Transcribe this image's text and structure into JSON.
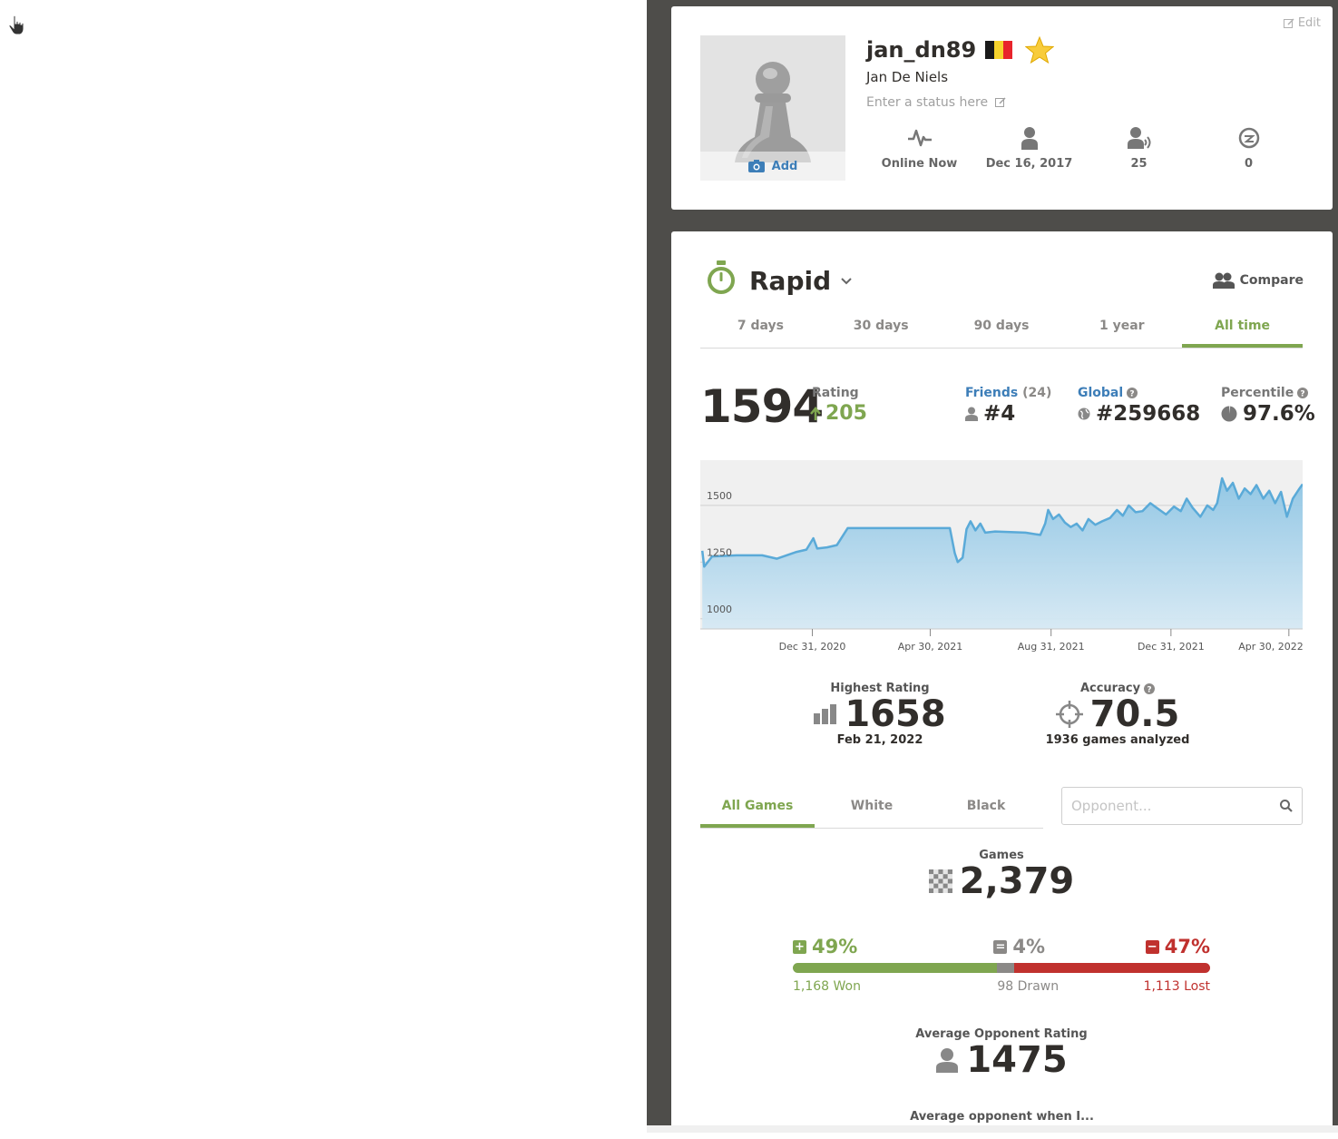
{
  "profile": {
    "edit_label": "Edit",
    "avatar_add_label": "Add",
    "username": "jan_dn89",
    "full_name": "Jan De Niels",
    "status_placeholder": "Enter a status here",
    "stats": [
      {
        "icon": "activity-icon",
        "value": "Online Now"
      },
      {
        "icon": "joined-user-icon",
        "value": "Dec 16, 2017"
      },
      {
        "icon": "followers-icon",
        "value": "25"
      },
      {
        "icon": "views-icon",
        "value": "0"
      }
    ]
  },
  "game_mode": {
    "title": "Rapid",
    "compare_label": "Compare",
    "time_ranges": [
      "7 days",
      "30 days",
      "90 days",
      "1 year",
      "All time"
    ],
    "active_range": "All time"
  },
  "rating": {
    "current": "1594",
    "label": "Rating",
    "change": "205",
    "friends_label": "Friends",
    "friends_count": "(24)",
    "friends_rank": "#4",
    "global_label": "Global",
    "global_rank": "#259668",
    "percentile_label": "Percentile",
    "percentile": "97.6%"
  },
  "chart_data": {
    "type": "area",
    "x_tick_labels": [
      "Dec 31, 2020",
      "Apr 30, 2021",
      "Aug 31, 2021",
      "Dec 31, 2021",
      "Apr 30, 2022"
    ],
    "y_tick_labels": [
      "1500",
      "1250",
      "1000"
    ],
    "ylim": [
      955,
      1700
    ],
    "grid": true,
    "series": [
      {
        "x": [
          "2020-09-10",
          "2020-09-12",
          "2020-09-20",
          "2020-10-15",
          "2020-11-10",
          "2020-11-25",
          "2020-12-15",
          "2020-12-25",
          "2021-01-01",
          "2021-01-05",
          "2021-01-15",
          "2021-01-25",
          "2021-02-05",
          "2021-02-12",
          "2021-02-18",
          "2021-03-20",
          "2021-04-30",
          "2021-05-20",
          "2021-05-25",
          "2021-05-28",
          "2021-06-02",
          "2021-06-06",
          "2021-06-10",
          "2021-06-15",
          "2021-06-20",
          "2021-06-25",
          "2021-07-05",
          "2021-08-05",
          "2021-08-20",
          "2021-08-25",
          "2021-08-28",
          "2021-09-02",
          "2021-09-08",
          "2021-09-14",
          "2021-09-20",
          "2021-09-26",
          "2021-10-02",
          "2021-10-08",
          "2021-10-15",
          "2021-10-22",
          "2021-10-30",
          "2021-11-06",
          "2021-11-12",
          "2021-11-18",
          "2021-11-25",
          "2021-12-02",
          "2021-12-10",
          "2021-12-18",
          "2021-12-26",
          "2022-01-03",
          "2022-01-10",
          "2022-01-16",
          "2022-01-22",
          "2022-01-30",
          "2022-02-06",
          "2022-02-12",
          "2022-02-16",
          "2022-02-21",
          "2022-02-26",
          "2022-03-04",
          "2022-03-10",
          "2022-03-16",
          "2022-03-22",
          "2022-03-28",
          "2022-04-04",
          "2022-04-10",
          "2022-04-16",
          "2022-04-22",
          "2022-04-28",
          "2022-05-04",
          "2022-05-10",
          "2022-05-14"
        ],
        "y": [
          1300,
          1230,
          1275,
          1280,
          1280,
          1265,
          1295,
          1305,
          1355,
          1310,
          1315,
          1325,
          1400,
          1400,
          1400,
          1400,
          1400,
          1400,
          1290,
          1250,
          1270,
          1395,
          1430,
          1390,
          1420,
          1380,
          1385,
          1380,
          1370,
          1420,
          1480,
          1440,
          1460,
          1425,
          1405,
          1420,
          1390,
          1440,
          1415,
          1430,
          1445,
          1480,
          1455,
          1500,
          1470,
          1475,
          1510,
          1485,
          1460,
          1495,
          1475,
          1530,
          1490,
          1450,
          1500,
          1480,
          1510,
          1620,
          1565,
          1600,
          1530,
          1575,
          1550,
          1590,
          1530,
          1565,
          1510,
          1560,
          1450,
          1530,
          1570,
          1594
        ]
      }
    ]
  },
  "highest_rating": {
    "label": "Highest Rating",
    "value": "1658",
    "date": "Feb 21, 2022"
  },
  "accuracy": {
    "label": "Accuracy",
    "value": "70.5",
    "sub": "1936 games analyzed"
  },
  "games_filter": {
    "tabs": [
      "All Games",
      "White",
      "Black"
    ],
    "active": "All Games",
    "opponent_placeholder": "Opponent..."
  },
  "games": {
    "label": "Games",
    "total": "2,379",
    "won_pct": "49%",
    "drawn_pct": "4%",
    "lost_pct": "47%",
    "won_fraction": 0.49,
    "drawn_fraction": 0.04,
    "lost_fraction": 0.47,
    "won_label": "1,168 Won",
    "drawn_label": "98 Drawn",
    "lost_label": "1,113 Lost"
  },
  "avg_opponent": {
    "label": "Average Opponent Rating",
    "value": "1475"
  },
  "avg_opponent_when": "Average opponent when I...",
  "colors": {
    "green": "#7fa650",
    "red": "#c0312e",
    "gray": "#8b8987",
    "blue": "#3d7eb8",
    "chart_line": "#5aaad8"
  }
}
